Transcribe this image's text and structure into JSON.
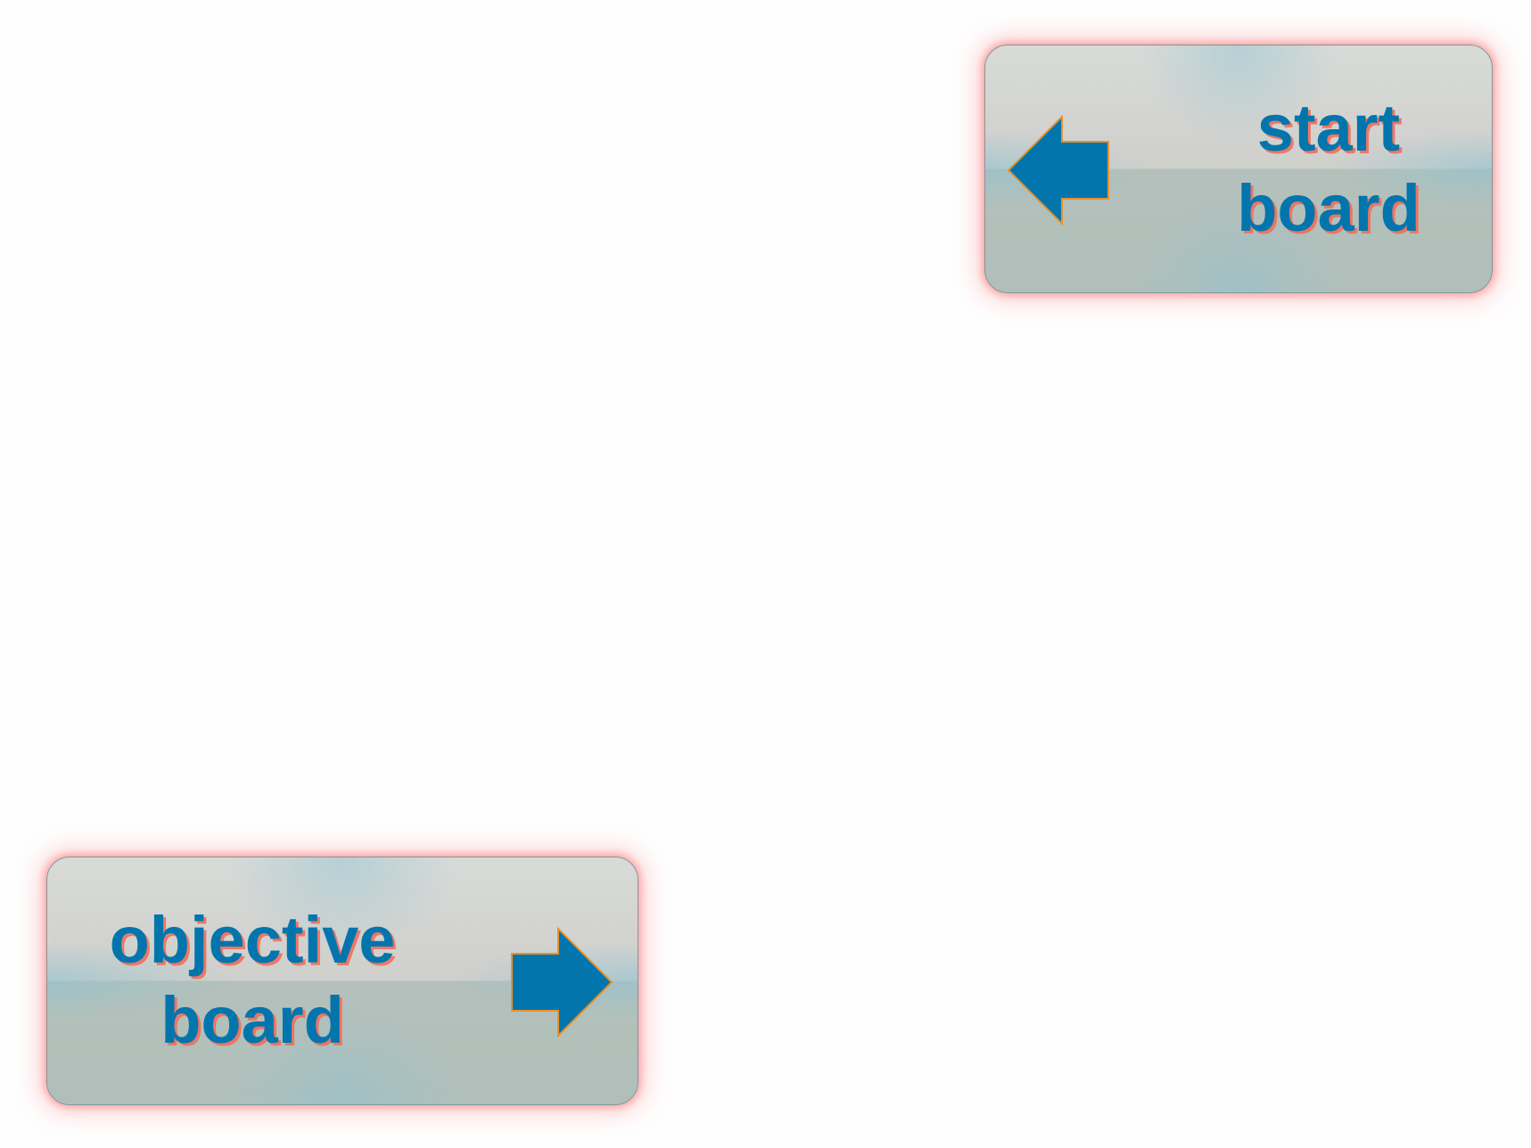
{
  "buttons": {
    "start_board": {
      "line1": "start",
      "line2": "board",
      "icon": "arrow-left-icon"
    },
    "objective_board": {
      "line1": "objective",
      "line2": "board",
      "icon": "arrow-right-icon"
    }
  },
  "colors": {
    "text": "#0375ad",
    "text_shadow": "#f06e5a",
    "arrow_fill": "#0375ad",
    "arrow_stroke": "#e8912b",
    "button_glow": "#ff7878"
  }
}
